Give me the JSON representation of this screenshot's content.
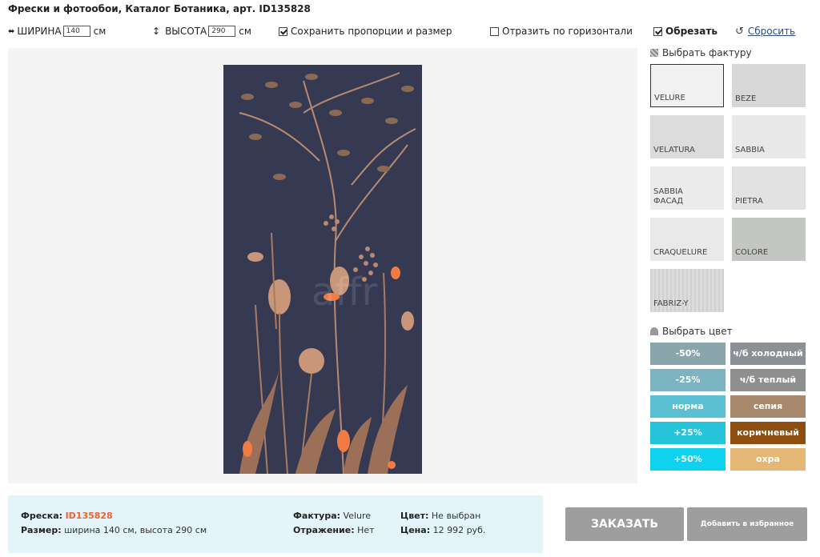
{
  "title": "Фрески и фотообои, Каталог Ботаника, арт. ID135828",
  "toolbar": {
    "width_label": "ШИРИНА",
    "width_value": "140",
    "width_unit": "см",
    "height_label": "ВЫСОТА",
    "height_value": "290",
    "height_unit": "см",
    "keep_proportions": {
      "label": "Сохранить пропорции и размер",
      "checked": true
    },
    "mirror": {
      "label": "Отразить по горизонтали",
      "checked": false
    },
    "crop": {
      "label": "Обрезать",
      "checked": true
    },
    "reset": "Сбросить"
  },
  "preview": {
    "watermark": "affr",
    "palette": {
      "background": "#353a52",
      "leaf_dark": "#8a6a55",
      "leaf_light": "#c9967a",
      "accent": "#f07b45",
      "branch": "#b98a6f"
    }
  },
  "sidebar": {
    "texture_title": "Выбрать фактуру",
    "textures": [
      {
        "name": "VELURE",
        "selected": true
      },
      {
        "name": "BEZE",
        "selected": false
      },
      {
        "name": "VELATURA",
        "selected": false
      },
      {
        "name": "SABBIA",
        "selected": false
      },
      {
        "name": "SABBIA ФАСАД",
        "selected": false
      },
      {
        "name": "PIETRA",
        "selected": false
      },
      {
        "name": "CRAQUELURE",
        "selected": false
      },
      {
        "name": "COLORE",
        "selected": false
      },
      {
        "name": "FABRIZ-Y",
        "selected": false
      }
    ],
    "color_title": "Выбрать цвет",
    "colors": [
      {
        "label": "-50%",
        "color": "#8aa5ac"
      },
      {
        "label": "ч/б холодный",
        "color": "#8c8f93"
      },
      {
        "label": "-25%",
        "color": "#7db4c2"
      },
      {
        "label": "ч/б теплый",
        "color": "#8f8f8f"
      },
      {
        "label": "норма",
        "color": "#5bbfd3"
      },
      {
        "label": "сепия",
        "color": "#a9896b"
      },
      {
        "label": "+25%",
        "color": "#25c4da"
      },
      {
        "label": "коричневый",
        "color": "#8d4e10"
      },
      {
        "label": "+50%",
        "color": "#0fd3ee"
      },
      {
        "label": "охра",
        "color": "#e4b874"
      }
    ]
  },
  "summary": {
    "fresco_label": "Фреска:",
    "fresco_id": "ID135828",
    "size_label": "Размер:",
    "size_value": "ширина 140 см, высота 290 см",
    "texture_label": "Фактура:",
    "texture_value": "Velure",
    "mirror_label": "Отражение:",
    "mirror_value": "Нет",
    "color_label": "Цвет:",
    "color_value": "Не выбран",
    "price_label": "Цена:",
    "price_value": "12 992 руб."
  },
  "actions": {
    "order": "ЗАКАЗАТЬ",
    "favorite": "Добавить в избранное"
  }
}
